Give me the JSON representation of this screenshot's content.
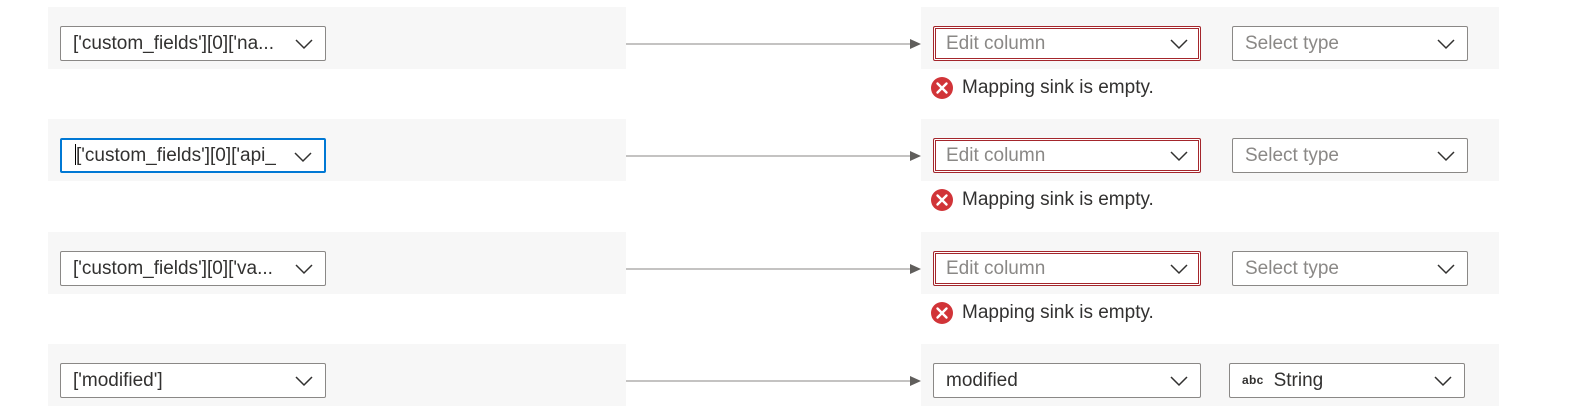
{
  "colors": {
    "error": "#d13438",
    "focus": "#0078d4",
    "band": "#f7f7f7"
  },
  "icons": {
    "chevron": "chevron-down-icon",
    "error": "error-circle-icon",
    "string_type": "abc-type-icon"
  },
  "rows": [
    {
      "source": "['custom_fields'][0]['na...",
      "sink_value": "Edit column",
      "type_value": "Select type",
      "error": "Mapping sink is empty."
    },
    {
      "source": "['custom_fields'][0]['api_",
      "sink_value": "Edit column",
      "type_value": "Select type",
      "error": "Mapping sink is empty."
    },
    {
      "source": "['custom_fields'][0]['va...",
      "sink_value": "Edit column",
      "type_value": "Select type",
      "error": "Mapping sink is empty."
    },
    {
      "source": "['modified']",
      "sink_value": "modified",
      "type_icon_label": "abc",
      "type_value": "String"
    }
  ]
}
